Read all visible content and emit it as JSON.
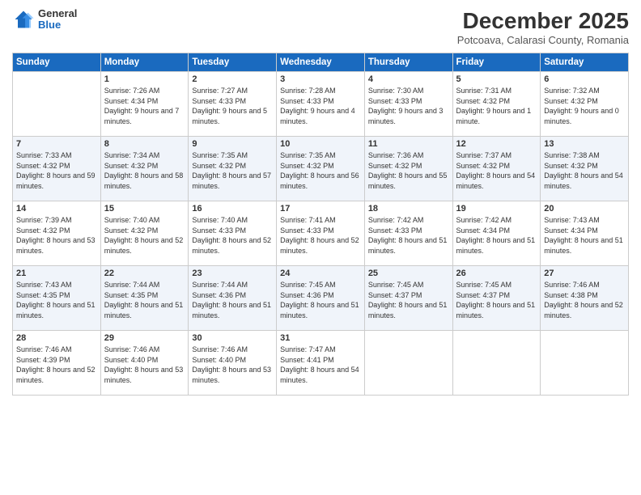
{
  "logo": {
    "general": "General",
    "blue": "Blue"
  },
  "header": {
    "month_year": "December 2025",
    "location": "Potcoava, Calarasi County, Romania"
  },
  "days_of_week": [
    "Sunday",
    "Monday",
    "Tuesday",
    "Wednesday",
    "Thursday",
    "Friday",
    "Saturday"
  ],
  "weeks": [
    [
      {
        "day": "",
        "sunrise": "",
        "sunset": "",
        "daylight": ""
      },
      {
        "day": "1",
        "sunrise": "Sunrise: 7:26 AM",
        "sunset": "Sunset: 4:34 PM",
        "daylight": "Daylight: 9 hours and 7 minutes."
      },
      {
        "day": "2",
        "sunrise": "Sunrise: 7:27 AM",
        "sunset": "Sunset: 4:33 PM",
        "daylight": "Daylight: 9 hours and 5 minutes."
      },
      {
        "day": "3",
        "sunrise": "Sunrise: 7:28 AM",
        "sunset": "Sunset: 4:33 PM",
        "daylight": "Daylight: 9 hours and 4 minutes."
      },
      {
        "day": "4",
        "sunrise": "Sunrise: 7:30 AM",
        "sunset": "Sunset: 4:33 PM",
        "daylight": "Daylight: 9 hours and 3 minutes."
      },
      {
        "day": "5",
        "sunrise": "Sunrise: 7:31 AM",
        "sunset": "Sunset: 4:32 PM",
        "daylight": "Daylight: 9 hours and 1 minute."
      },
      {
        "day": "6",
        "sunrise": "Sunrise: 7:32 AM",
        "sunset": "Sunset: 4:32 PM",
        "daylight": "Daylight: 9 hours and 0 minutes."
      }
    ],
    [
      {
        "day": "7",
        "sunrise": "Sunrise: 7:33 AM",
        "sunset": "Sunset: 4:32 PM",
        "daylight": "Daylight: 8 hours and 59 minutes."
      },
      {
        "day": "8",
        "sunrise": "Sunrise: 7:34 AM",
        "sunset": "Sunset: 4:32 PM",
        "daylight": "Daylight: 8 hours and 58 minutes."
      },
      {
        "day": "9",
        "sunrise": "Sunrise: 7:35 AM",
        "sunset": "Sunset: 4:32 PM",
        "daylight": "Daylight: 8 hours and 57 minutes."
      },
      {
        "day": "10",
        "sunrise": "Sunrise: 7:35 AM",
        "sunset": "Sunset: 4:32 PM",
        "daylight": "Daylight: 8 hours and 56 minutes."
      },
      {
        "day": "11",
        "sunrise": "Sunrise: 7:36 AM",
        "sunset": "Sunset: 4:32 PM",
        "daylight": "Daylight: 8 hours and 55 minutes."
      },
      {
        "day": "12",
        "sunrise": "Sunrise: 7:37 AM",
        "sunset": "Sunset: 4:32 PM",
        "daylight": "Daylight: 8 hours and 54 minutes."
      },
      {
        "day": "13",
        "sunrise": "Sunrise: 7:38 AM",
        "sunset": "Sunset: 4:32 PM",
        "daylight": "Daylight: 8 hours and 54 minutes."
      }
    ],
    [
      {
        "day": "14",
        "sunrise": "Sunrise: 7:39 AM",
        "sunset": "Sunset: 4:32 PM",
        "daylight": "Daylight: 8 hours and 53 minutes."
      },
      {
        "day": "15",
        "sunrise": "Sunrise: 7:40 AM",
        "sunset": "Sunset: 4:32 PM",
        "daylight": "Daylight: 8 hours and 52 minutes."
      },
      {
        "day": "16",
        "sunrise": "Sunrise: 7:40 AM",
        "sunset": "Sunset: 4:33 PM",
        "daylight": "Daylight: 8 hours and 52 minutes."
      },
      {
        "day": "17",
        "sunrise": "Sunrise: 7:41 AM",
        "sunset": "Sunset: 4:33 PM",
        "daylight": "Daylight: 8 hours and 52 minutes."
      },
      {
        "day": "18",
        "sunrise": "Sunrise: 7:42 AM",
        "sunset": "Sunset: 4:33 PM",
        "daylight": "Daylight: 8 hours and 51 minutes."
      },
      {
        "day": "19",
        "sunrise": "Sunrise: 7:42 AM",
        "sunset": "Sunset: 4:34 PM",
        "daylight": "Daylight: 8 hours and 51 minutes."
      },
      {
        "day": "20",
        "sunrise": "Sunrise: 7:43 AM",
        "sunset": "Sunset: 4:34 PM",
        "daylight": "Daylight: 8 hours and 51 minutes."
      }
    ],
    [
      {
        "day": "21",
        "sunrise": "Sunrise: 7:43 AM",
        "sunset": "Sunset: 4:35 PM",
        "daylight": "Daylight: 8 hours and 51 minutes."
      },
      {
        "day": "22",
        "sunrise": "Sunrise: 7:44 AM",
        "sunset": "Sunset: 4:35 PM",
        "daylight": "Daylight: 8 hours and 51 minutes."
      },
      {
        "day": "23",
        "sunrise": "Sunrise: 7:44 AM",
        "sunset": "Sunset: 4:36 PM",
        "daylight": "Daylight: 8 hours and 51 minutes."
      },
      {
        "day": "24",
        "sunrise": "Sunrise: 7:45 AM",
        "sunset": "Sunset: 4:36 PM",
        "daylight": "Daylight: 8 hours and 51 minutes."
      },
      {
        "day": "25",
        "sunrise": "Sunrise: 7:45 AM",
        "sunset": "Sunset: 4:37 PM",
        "daylight": "Daylight: 8 hours and 51 minutes."
      },
      {
        "day": "26",
        "sunrise": "Sunrise: 7:45 AM",
        "sunset": "Sunset: 4:37 PM",
        "daylight": "Daylight: 8 hours and 51 minutes."
      },
      {
        "day": "27",
        "sunrise": "Sunrise: 7:46 AM",
        "sunset": "Sunset: 4:38 PM",
        "daylight": "Daylight: 8 hours and 52 minutes."
      }
    ],
    [
      {
        "day": "28",
        "sunrise": "Sunrise: 7:46 AM",
        "sunset": "Sunset: 4:39 PM",
        "daylight": "Daylight: 8 hours and 52 minutes."
      },
      {
        "day": "29",
        "sunrise": "Sunrise: 7:46 AM",
        "sunset": "Sunset: 4:40 PM",
        "daylight": "Daylight: 8 hours and 53 minutes."
      },
      {
        "day": "30",
        "sunrise": "Sunrise: 7:46 AM",
        "sunset": "Sunset: 4:40 PM",
        "daylight": "Daylight: 8 hours and 53 minutes."
      },
      {
        "day": "31",
        "sunrise": "Sunrise: 7:47 AM",
        "sunset": "Sunset: 4:41 PM",
        "daylight": "Daylight: 8 hours and 54 minutes."
      },
      {
        "day": "",
        "sunrise": "",
        "sunset": "",
        "daylight": ""
      },
      {
        "day": "",
        "sunrise": "",
        "sunset": "",
        "daylight": ""
      },
      {
        "day": "",
        "sunrise": "",
        "sunset": "",
        "daylight": ""
      }
    ]
  ]
}
